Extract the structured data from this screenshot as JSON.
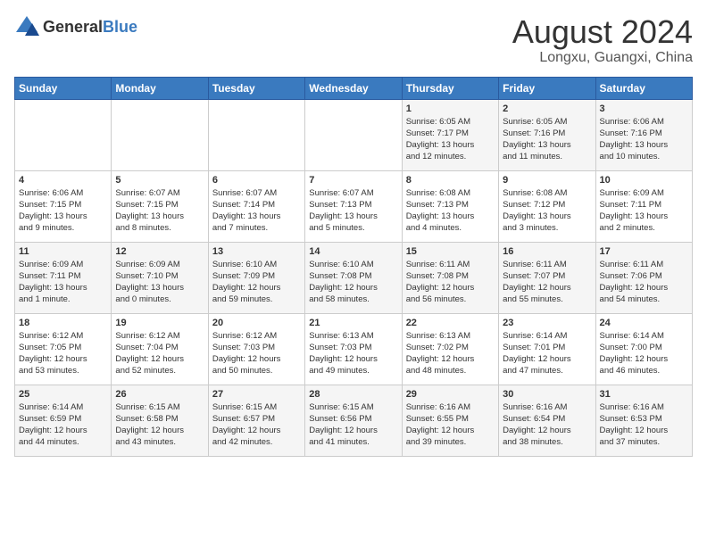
{
  "header": {
    "logo_general": "General",
    "logo_blue": "Blue",
    "month_year": "August 2024",
    "location": "Longxu, Guangxi, China"
  },
  "days_of_week": [
    "Sunday",
    "Monday",
    "Tuesday",
    "Wednesday",
    "Thursday",
    "Friday",
    "Saturday"
  ],
  "weeks": [
    [
      {
        "day": "",
        "info": ""
      },
      {
        "day": "",
        "info": ""
      },
      {
        "day": "",
        "info": ""
      },
      {
        "day": "",
        "info": ""
      },
      {
        "day": "1",
        "info": "Sunrise: 6:05 AM\nSunset: 7:17 PM\nDaylight: 13 hours\nand 12 minutes."
      },
      {
        "day": "2",
        "info": "Sunrise: 6:05 AM\nSunset: 7:16 PM\nDaylight: 13 hours\nand 11 minutes."
      },
      {
        "day": "3",
        "info": "Sunrise: 6:06 AM\nSunset: 7:16 PM\nDaylight: 13 hours\nand 10 minutes."
      }
    ],
    [
      {
        "day": "4",
        "info": "Sunrise: 6:06 AM\nSunset: 7:15 PM\nDaylight: 13 hours\nand 9 minutes."
      },
      {
        "day": "5",
        "info": "Sunrise: 6:07 AM\nSunset: 7:15 PM\nDaylight: 13 hours\nand 8 minutes."
      },
      {
        "day": "6",
        "info": "Sunrise: 6:07 AM\nSunset: 7:14 PM\nDaylight: 13 hours\nand 7 minutes."
      },
      {
        "day": "7",
        "info": "Sunrise: 6:07 AM\nSunset: 7:13 PM\nDaylight: 13 hours\nand 5 minutes."
      },
      {
        "day": "8",
        "info": "Sunrise: 6:08 AM\nSunset: 7:13 PM\nDaylight: 13 hours\nand 4 minutes."
      },
      {
        "day": "9",
        "info": "Sunrise: 6:08 AM\nSunset: 7:12 PM\nDaylight: 13 hours\nand 3 minutes."
      },
      {
        "day": "10",
        "info": "Sunrise: 6:09 AM\nSunset: 7:11 PM\nDaylight: 13 hours\nand 2 minutes."
      }
    ],
    [
      {
        "day": "11",
        "info": "Sunrise: 6:09 AM\nSunset: 7:11 PM\nDaylight: 13 hours\nand 1 minute."
      },
      {
        "day": "12",
        "info": "Sunrise: 6:09 AM\nSunset: 7:10 PM\nDaylight: 13 hours\nand 0 minutes."
      },
      {
        "day": "13",
        "info": "Sunrise: 6:10 AM\nSunset: 7:09 PM\nDaylight: 12 hours\nand 59 minutes."
      },
      {
        "day": "14",
        "info": "Sunrise: 6:10 AM\nSunset: 7:08 PM\nDaylight: 12 hours\nand 58 minutes."
      },
      {
        "day": "15",
        "info": "Sunrise: 6:11 AM\nSunset: 7:08 PM\nDaylight: 12 hours\nand 56 minutes."
      },
      {
        "day": "16",
        "info": "Sunrise: 6:11 AM\nSunset: 7:07 PM\nDaylight: 12 hours\nand 55 minutes."
      },
      {
        "day": "17",
        "info": "Sunrise: 6:11 AM\nSunset: 7:06 PM\nDaylight: 12 hours\nand 54 minutes."
      }
    ],
    [
      {
        "day": "18",
        "info": "Sunrise: 6:12 AM\nSunset: 7:05 PM\nDaylight: 12 hours\nand 53 minutes."
      },
      {
        "day": "19",
        "info": "Sunrise: 6:12 AM\nSunset: 7:04 PM\nDaylight: 12 hours\nand 52 minutes."
      },
      {
        "day": "20",
        "info": "Sunrise: 6:12 AM\nSunset: 7:03 PM\nDaylight: 12 hours\nand 50 minutes."
      },
      {
        "day": "21",
        "info": "Sunrise: 6:13 AM\nSunset: 7:03 PM\nDaylight: 12 hours\nand 49 minutes."
      },
      {
        "day": "22",
        "info": "Sunrise: 6:13 AM\nSunset: 7:02 PM\nDaylight: 12 hours\nand 48 minutes."
      },
      {
        "day": "23",
        "info": "Sunrise: 6:14 AM\nSunset: 7:01 PM\nDaylight: 12 hours\nand 47 minutes."
      },
      {
        "day": "24",
        "info": "Sunrise: 6:14 AM\nSunset: 7:00 PM\nDaylight: 12 hours\nand 46 minutes."
      }
    ],
    [
      {
        "day": "25",
        "info": "Sunrise: 6:14 AM\nSunset: 6:59 PM\nDaylight: 12 hours\nand 44 minutes."
      },
      {
        "day": "26",
        "info": "Sunrise: 6:15 AM\nSunset: 6:58 PM\nDaylight: 12 hours\nand 43 minutes."
      },
      {
        "day": "27",
        "info": "Sunrise: 6:15 AM\nSunset: 6:57 PM\nDaylight: 12 hours\nand 42 minutes."
      },
      {
        "day": "28",
        "info": "Sunrise: 6:15 AM\nSunset: 6:56 PM\nDaylight: 12 hours\nand 41 minutes."
      },
      {
        "day": "29",
        "info": "Sunrise: 6:16 AM\nSunset: 6:55 PM\nDaylight: 12 hours\nand 39 minutes."
      },
      {
        "day": "30",
        "info": "Sunrise: 6:16 AM\nSunset: 6:54 PM\nDaylight: 12 hours\nand 38 minutes."
      },
      {
        "day": "31",
        "info": "Sunrise: 6:16 AM\nSunset: 6:53 PM\nDaylight: 12 hours\nand 37 minutes."
      }
    ]
  ]
}
